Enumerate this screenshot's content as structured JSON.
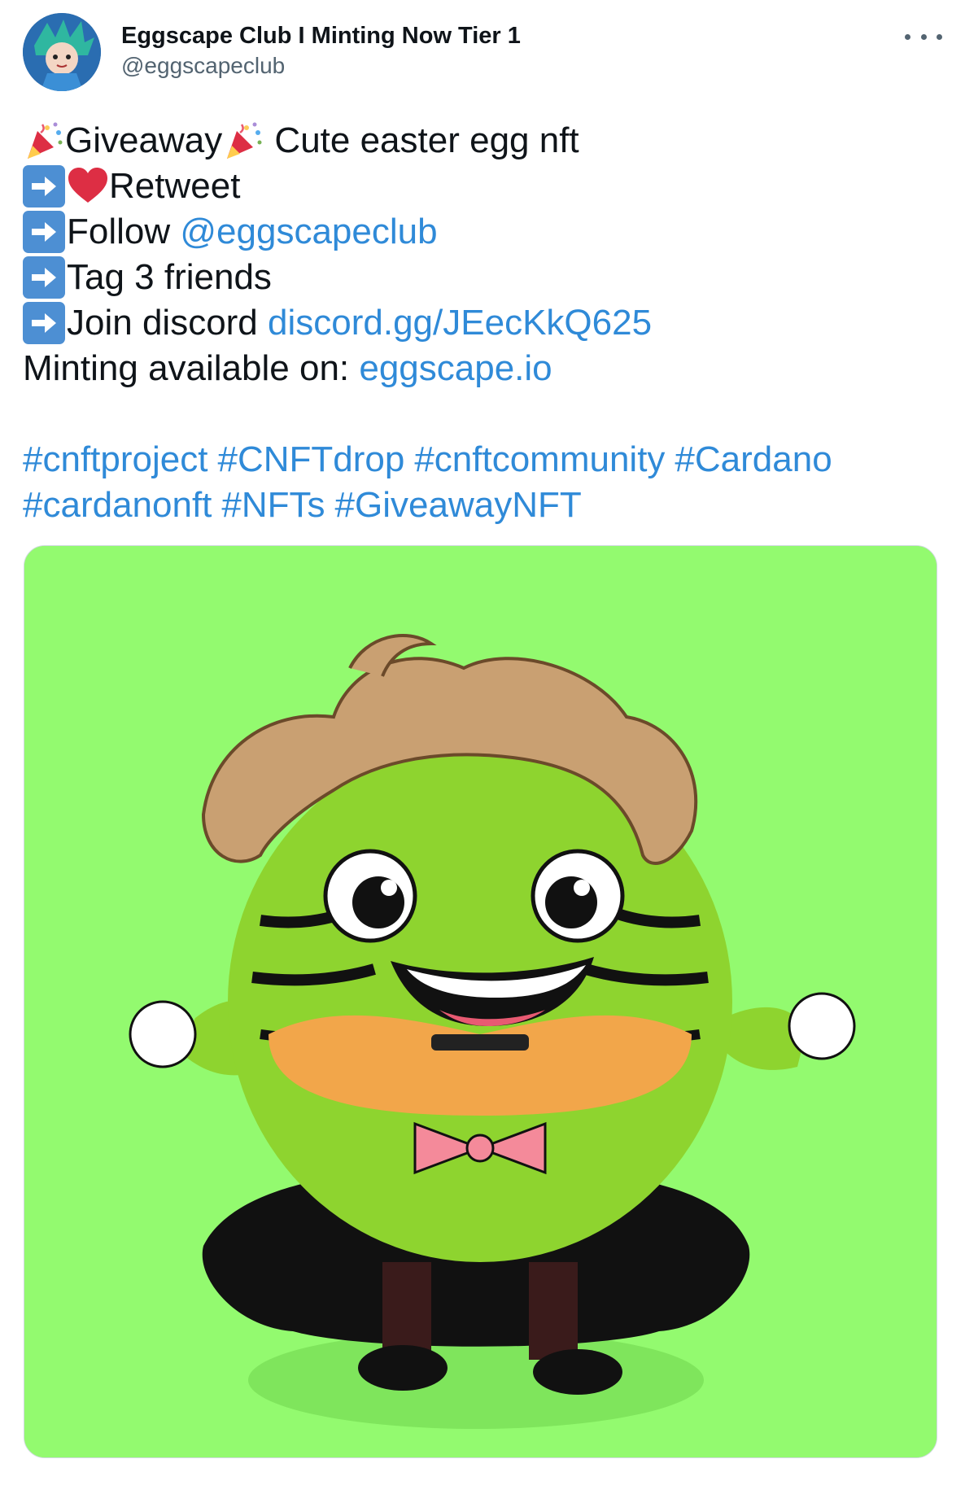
{
  "tweet": {
    "author": {
      "display_name": "Eggscape Club I Minting Now Tier 1",
      "handle": "@eggscapeclub"
    },
    "more_icon": "more-horizontal-icon",
    "lines": {
      "giveaway": "Giveaway",
      "title_rest": " Cute easter egg nft",
      "retweet": "Retweet",
      "follow": "Follow ",
      "follow_link": "@eggscapeclub",
      "tag": "Tag 3 friends",
      "join": "Join discord ",
      "discord_link": "discord.gg/JEecKkQ625",
      "minting": "Minting available on: ",
      "minting_link": "eggscape.io"
    },
    "hashtags": [
      "#cnftproject",
      "#CNFTdrop",
      "#cnftcommunity",
      "#Cardano",
      "#cardanonft",
      "#NFTs",
      "#GiveawayNFT"
    ],
    "icons": {
      "party": "party-popper-icon",
      "arrow": "right-arrow-icon",
      "heart": "heart-icon"
    },
    "media": {
      "subject": "egg-character-nft-image",
      "background_color": "#93fa6f"
    },
    "colors": {
      "link": "#2f8ad8",
      "text": "#0f1419",
      "secondary": "#536471"
    }
  }
}
